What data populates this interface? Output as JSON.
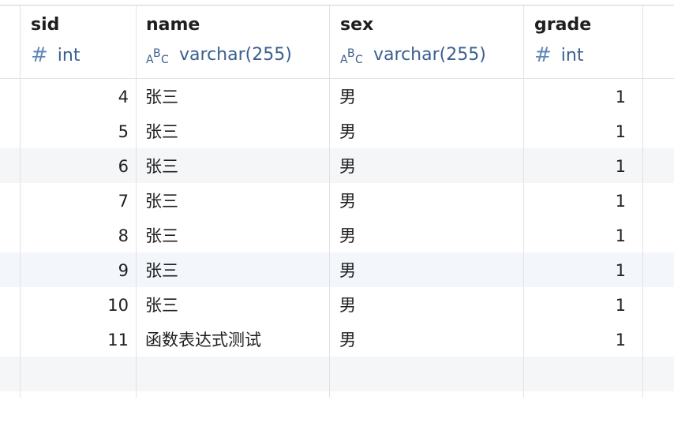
{
  "columns": [
    {
      "name": "sid",
      "type": "int",
      "icon": "hash-icon"
    },
    {
      "name": "name",
      "type": "varchar(255)",
      "icon": "abc-icon"
    },
    {
      "name": "sex",
      "type": "varchar(255)",
      "icon": "abc-icon"
    },
    {
      "name": "grade",
      "type": "int",
      "icon": "hash-icon"
    }
  ],
  "rows": [
    {
      "sid": "4",
      "name": "张三",
      "sex": "男",
      "grade": "1"
    },
    {
      "sid": "5",
      "name": "张三",
      "sex": "男",
      "grade": "1"
    },
    {
      "sid": "6",
      "name": "张三",
      "sex": "男",
      "grade": "1"
    },
    {
      "sid": "7",
      "name": "张三",
      "sex": "男",
      "grade": "1"
    },
    {
      "sid": "8",
      "name": "张三",
      "sex": "男",
      "grade": "1"
    },
    {
      "sid": "9",
      "name": "张三",
      "sex": "男",
      "grade": "1"
    },
    {
      "sid": "10",
      "name": "张三",
      "sex": "男",
      "grade": "1"
    },
    {
      "sid": "11",
      "name": "函数表达式测试",
      "sex": "男",
      "grade": "1"
    },
    {
      "sid": "",
      "name": "",
      "sex": "",
      "grade": ""
    },
    {
      "sid": "",
      "name": "",
      "sex": "",
      "grade": ""
    }
  ],
  "colors": {
    "type_text": "#3a5f8f",
    "row_alt": "#f5f6f8",
    "selected_row": "#f3f6fb"
  }
}
